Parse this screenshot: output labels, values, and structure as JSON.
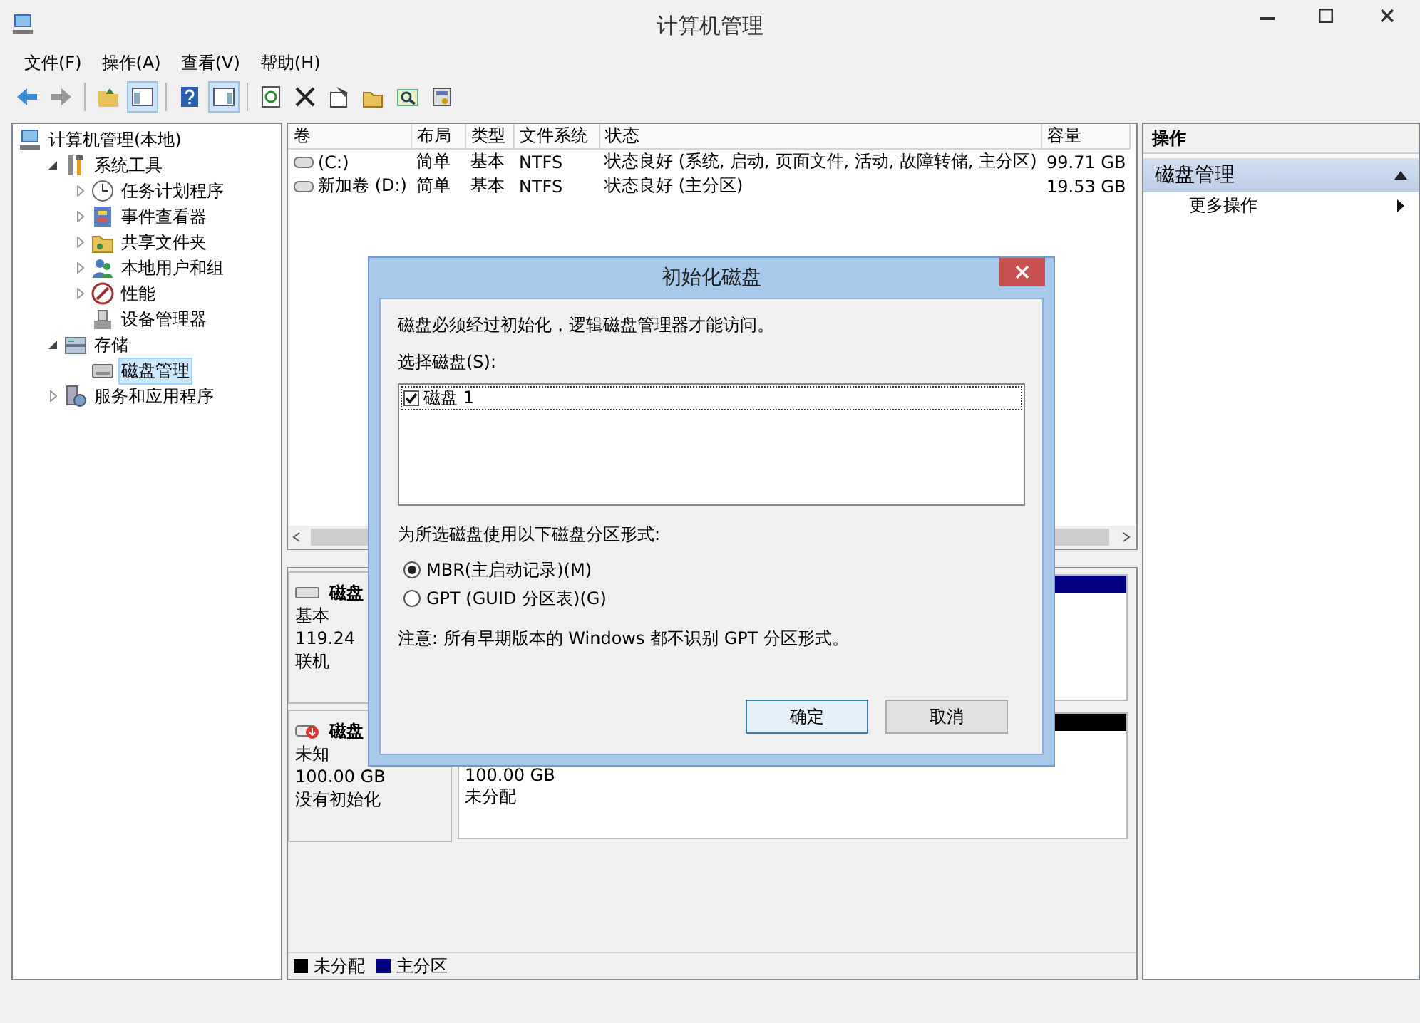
{
  "window": {
    "title": "计算机管理"
  },
  "menu": [
    "文件(F)",
    "操作(A)",
    "查看(V)",
    "帮助(H)"
  ],
  "tree": {
    "items": [
      {
        "label": "计算机管理(本地)",
        "kind": "computer",
        "selected": false,
        "children": [
          {
            "label": "系统工具",
            "kind": "tools",
            "expanded": true,
            "selected": false,
            "children": [
              {
                "label": "任务计划程序",
                "kind": "clock",
                "expanded": false,
                "selected": false
              },
              {
                "label": "事件查看器",
                "kind": "event",
                "expanded": false,
                "selected": false
              },
              {
                "label": "共享文件夹",
                "kind": "folder",
                "expanded": false,
                "selected": false
              },
              {
                "label": "本地用户和组",
                "kind": "users",
                "expanded": false,
                "selected": false
              },
              {
                "label": "性能",
                "kind": "performance",
                "expanded": false,
                "selected": false
              },
              {
                "label": "设备管理器",
                "kind": "device",
                "selected": false
              }
            ]
          },
          {
            "label": "存储",
            "kind": "storage",
            "expanded": true,
            "selected": false,
            "children": [
              {
                "label": "磁盘管理",
                "kind": "disk",
                "selected": true
              }
            ]
          },
          {
            "label": "服务和应用程序",
            "kind": "services",
            "expanded": false,
            "selected": false
          }
        ]
      }
    ]
  },
  "volumes": {
    "columns": [
      "卷",
      "布局",
      "类型",
      "文件系统",
      "状态",
      "容量"
    ],
    "rows": [
      [
        "(C:)",
        "简单",
        "基本",
        "NTFS",
        "状态良好 (系统, 启动, 页面文件, 活动, 故障转储, 主分区)",
        "99.71 GB"
      ],
      [
        "新加卷 (D:)",
        "简单",
        "基本",
        "NTFS",
        "状态良好 (主分区)",
        "19.53 GB"
      ]
    ]
  },
  "disks": [
    {
      "name": "磁盘",
      "kind": "basic",
      "lines": [
        "基本",
        "119.24",
        "联机"
      ],
      "partitions": [
        {
          "color": "#000080"
        }
      ]
    },
    {
      "name": "磁盘",
      "kind": "unknown",
      "lines": [
        "未知",
        "100.00 GB",
        "没有初始化"
      ],
      "partitions": [
        {
          "color": "#000000",
          "lines": [
            "100.00 GB",
            "未分配"
          ]
        }
      ]
    }
  ],
  "legend": [
    {
      "label": "未分配",
      "color": "#000000"
    },
    {
      "label": "主分区",
      "color": "#000080"
    }
  ],
  "actions": {
    "header": "操作",
    "sections": [
      {
        "title": "磁盘管理",
        "expanded": true,
        "items": [
          "更多操作"
        ]
      }
    ]
  },
  "dialog": {
    "title": "初始化磁盘",
    "message": "磁盘必须经过初始化，逻辑磁盘管理器才能访问。",
    "select_label": "选择磁盘(S):",
    "disks": [
      {
        "label": "磁盘 1",
        "checked": true
      }
    ],
    "style_label": "为所选磁盘使用以下磁盘分区形式:",
    "styles": [
      {
        "label": "MBR(主启动记录)(M)",
        "selected": true
      },
      {
        "label": "GPT (GUID 分区表)(G)",
        "selected": false
      }
    ],
    "note": "注意: 所有早期版本的 Windows 都不识别 GPT 分区形式。",
    "buttons": [
      {
        "label": "确定",
        "kind": "default"
      },
      {
        "label": "取消",
        "kind": "normal"
      }
    ]
  }
}
